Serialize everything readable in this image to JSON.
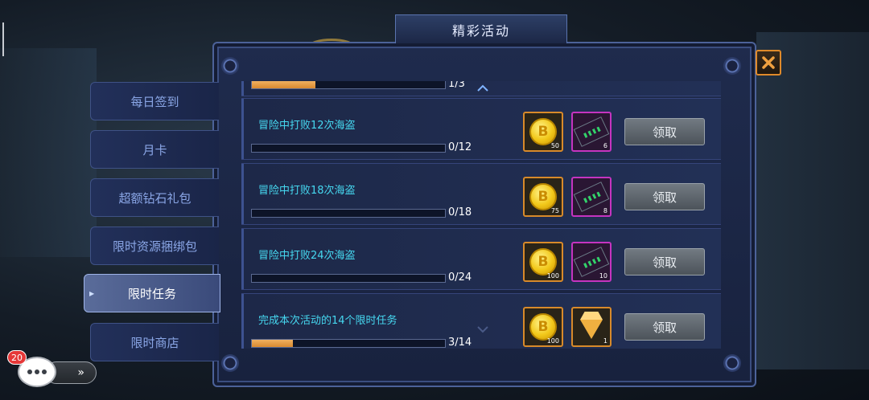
{
  "title": "精彩活动",
  "sidebar": {
    "tabs": [
      {
        "label": "每日签到",
        "active": false
      },
      {
        "label": "月卡",
        "active": false
      },
      {
        "label": "超额钻石礼包",
        "active": false
      },
      {
        "label": "限时资源捆绑包",
        "active": false
      },
      {
        "label": "限时任务",
        "active": true
      },
      {
        "label": "限时商店",
        "active": false
      }
    ]
  },
  "tasks": {
    "partial_top": {
      "progress": "1/3",
      "fraction": 0.33
    },
    "rows": [
      {
        "text": "冒险中打败12次海盗",
        "progress": "0/12",
        "fraction": 0,
        "rewards": [
          {
            "icon": "gold-coin-icon",
            "qty": "50"
          },
          {
            "icon": "chip-item-icon",
            "qty": "6"
          }
        ],
        "claim": "领取"
      },
      {
        "text": "冒险中打败18次海盗",
        "progress": "0/18",
        "fraction": 0,
        "rewards": [
          {
            "icon": "gold-coin-icon",
            "qty": "75"
          },
          {
            "icon": "chip-item-icon",
            "qty": "8"
          }
        ],
        "claim": "领取"
      },
      {
        "text": "冒险中打败24次海盗",
        "progress": "0/24",
        "fraction": 0,
        "rewards": [
          {
            "icon": "gold-coin-icon",
            "qty": "100"
          },
          {
            "icon": "chip-item-icon",
            "qty": "10"
          }
        ],
        "claim": "领取"
      },
      {
        "text": "完成本次活动的14个限时任务",
        "progress": "3/14",
        "fraction": 0.214,
        "rewards": [
          {
            "icon": "gold-coin-icon",
            "qty": "100"
          },
          {
            "icon": "gem-icon",
            "qty": "1"
          }
        ],
        "claim": "领取"
      }
    ]
  },
  "coin_glyph": "B",
  "chat": {
    "badge": "20",
    "expand": "»"
  },
  "colors": {
    "accent": "#46d8f0",
    "progress": "#e89a40",
    "close": "#e08a2a"
  }
}
